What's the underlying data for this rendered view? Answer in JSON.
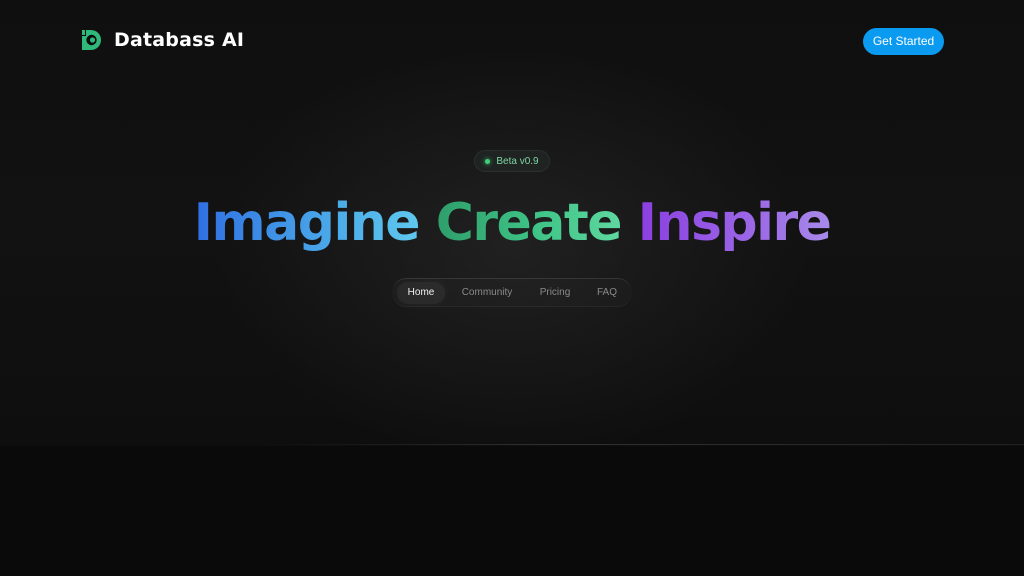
{
  "header": {
    "brand": "Databass AI",
    "cta_label": "Get Started"
  },
  "badge": {
    "label": "Beta v0.9"
  },
  "hero": {
    "words": [
      "Imagine",
      "Create",
      "Inspire"
    ]
  },
  "nav": {
    "items": [
      {
        "label": "Home",
        "active": true
      },
      {
        "label": "Community",
        "active": false
      },
      {
        "label": "Pricing",
        "active": false
      },
      {
        "label": "FAQ",
        "active": false
      }
    ]
  },
  "icons": {
    "logo": "databass-logo-icon",
    "badge_dot": "status-dot-icon"
  },
  "colors": {
    "accent": "#0a9af0",
    "brand_green": "#2fb87a",
    "status_green": "#3fd07a",
    "background": "#0b0b0b"
  }
}
